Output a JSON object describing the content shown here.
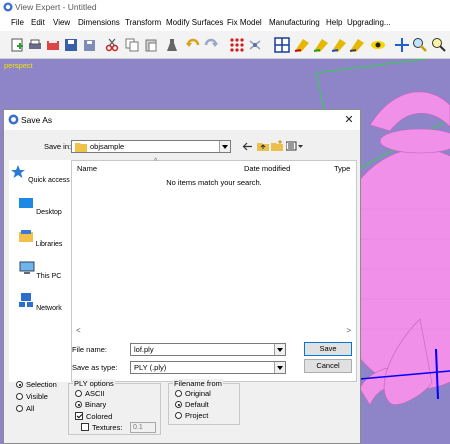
{
  "app": {
    "title": "View Expert - Untitled",
    "menu": [
      "File",
      "Edit",
      "View",
      "Dimensions",
      "Transform",
      "Modify Surfaces",
      "Fix Model",
      "Manufacturing",
      "Help",
      "Upgrading..."
    ],
    "viewport_label": "perspect"
  },
  "dialog": {
    "title": "Save As",
    "save_in_label": "Save in:",
    "save_in_value": "objsample",
    "places": [
      "Quick access",
      "Desktop",
      "Libraries",
      "This PC",
      "Network"
    ],
    "columns": [
      "Name",
      "Date modified",
      "Type"
    ],
    "empty_message": "No items match your search.",
    "file_name_label": "File name:",
    "file_name_value": "lof.ply",
    "save_as_type_label": "Save as type:",
    "save_as_type_value": "PLY (.ply)",
    "save_button": "Save",
    "cancel_button": "Cancel",
    "scope": [
      {
        "label": "Selection",
        "selected": true
      },
      {
        "label": "Visible",
        "selected": false
      },
      {
        "label": "All",
        "selected": false
      }
    ],
    "ply_options": {
      "title": "PLY options",
      "ascii": "ASCII",
      "binary": "Binary",
      "colored": "Colored",
      "textures": "Textures:",
      "textures_value": "0.1"
    },
    "filename_from": {
      "title": "Filename from",
      "original": "Original",
      "default": "Default",
      "project": "Project"
    }
  },
  "colors": {
    "viewport_bg": "#8e85c8",
    "teapot": "#f090e8",
    "bbox": "#2fd24a",
    "axis_blue": "#0000ff",
    "viewport_label": "#f2e400"
  }
}
